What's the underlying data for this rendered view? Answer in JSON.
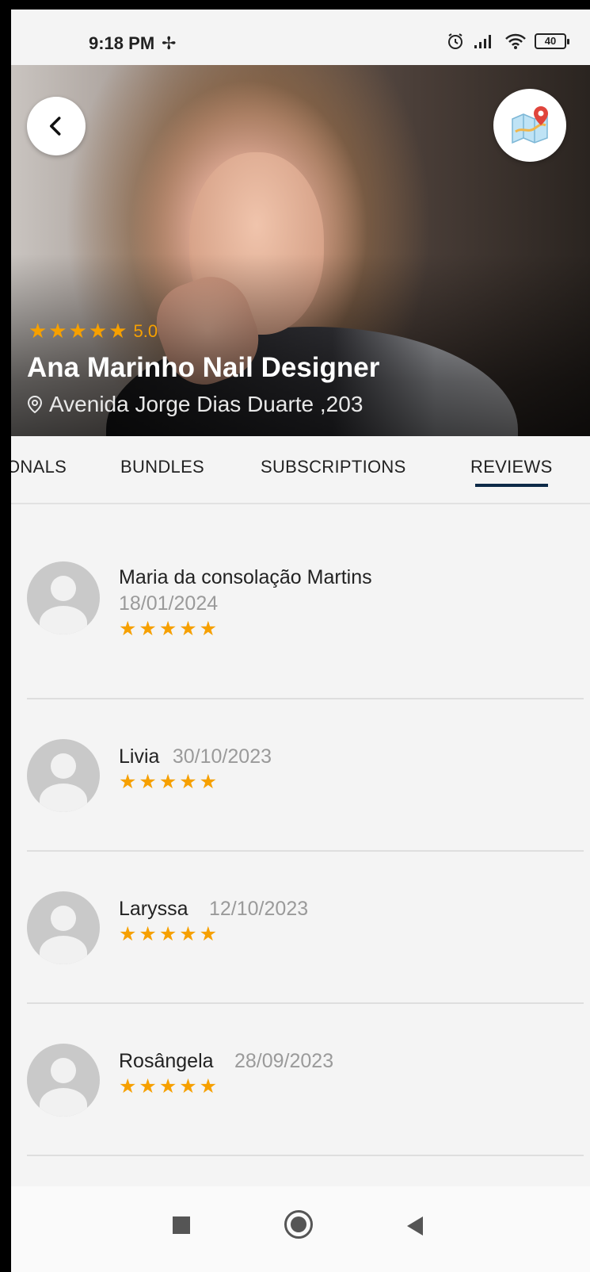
{
  "status_bar": {
    "time": "9:18 PM",
    "battery": "40"
  },
  "business": {
    "rating_stars": "★★★★★",
    "rating": "5.0",
    "name": "Ana Marinho Nail Designer",
    "address": "Avenida Jorge Dias Duarte ,203"
  },
  "tabs": [
    {
      "label": "ONALS"
    },
    {
      "label": "BUNDLES"
    },
    {
      "label": "SUBSCRIPTIONS"
    },
    {
      "label": "REVIEWS",
      "active": true
    }
  ],
  "reviews": [
    {
      "name": "Maria da consolação Martins",
      "date": "18/01/2024",
      "stars": "★★★★★"
    },
    {
      "name": "Livia",
      "date": "30/10/2023",
      "stars": "★★★★★"
    },
    {
      "name": "Laryssa",
      "date": "12/10/2023",
      "stars": "★★★★★"
    },
    {
      "name": "Rosângela",
      "date": "28/09/2023",
      "stars": "★★★★★"
    }
  ],
  "colors": {
    "accent_star": "#f6a000",
    "tab_indicator": "#0d2a48"
  }
}
